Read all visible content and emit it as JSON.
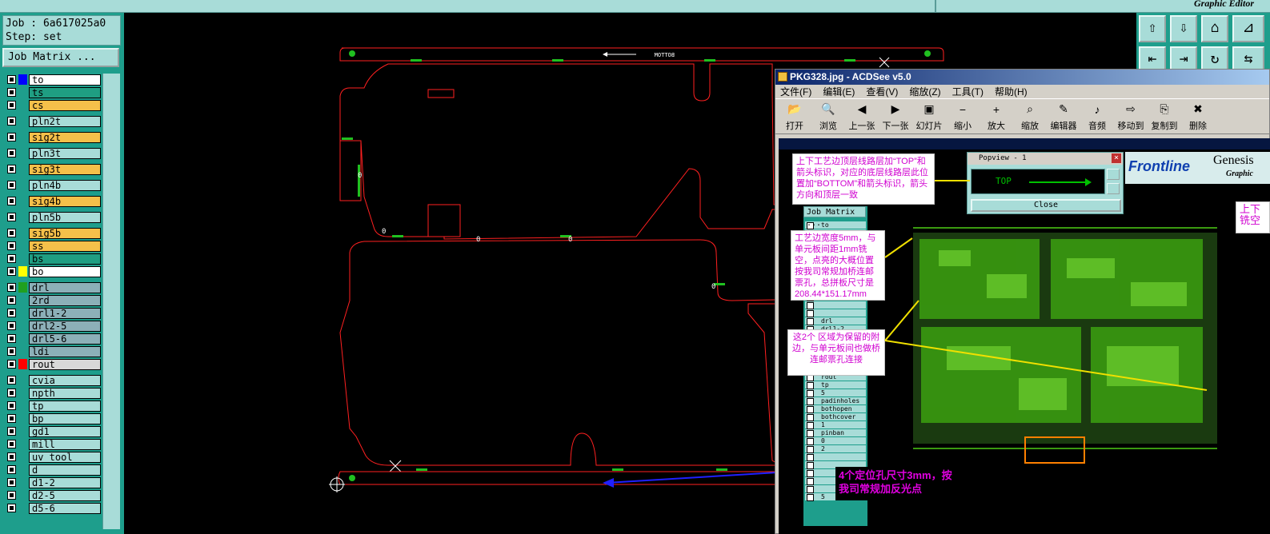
{
  "topbar": {
    "title": "Graphic Editor"
  },
  "job": {
    "job_line": "Job : 6a617025a0",
    "step_line": "Step: set"
  },
  "job_matrix_label": "Job Matrix ...",
  "layers": [
    {
      "name": "to",
      "color": "#0000ff",
      "bg": "#ffffff",
      "gap": false
    },
    {
      "name": "ts",
      "color": "",
      "bg": "#1f9e82",
      "gap": false
    },
    {
      "name": "cs",
      "color": "",
      "bg": "#f5c04a",
      "gap": false
    },
    {
      "name": "pln2t",
      "color": "",
      "bg": "#a8dcd8",
      "gap": true
    },
    {
      "name": "sig2t",
      "color": "",
      "bg": "#f5c04a",
      "gap": true
    },
    {
      "name": "pln3t",
      "color": "",
      "bg": "#a8dcd8",
      "gap": true
    },
    {
      "name": "sig3t",
      "color": "",
      "bg": "#f5c04a",
      "gap": true
    },
    {
      "name": "pln4b",
      "color": "",
      "bg": "#a8dcd8",
      "gap": true
    },
    {
      "name": "sig4b",
      "color": "",
      "bg": "#f5c04a",
      "gap": true
    },
    {
      "name": "pln5b",
      "color": "",
      "bg": "#a8dcd8",
      "gap": true
    },
    {
      "name": "sig5b",
      "color": "",
      "bg": "#f5c04a",
      "gap": true
    },
    {
      "name": "ss",
      "color": "",
      "bg": "#f5c04a",
      "gap": false
    },
    {
      "name": "bs",
      "color": "",
      "bg": "#1f9e82",
      "gap": false
    },
    {
      "name": "bo",
      "color": "#ffff00",
      "bg": "#ffffff",
      "gap": false
    },
    {
      "name": "drl",
      "color": "#20a020",
      "bg": "#8cb0b8",
      "gap": true
    },
    {
      "name": "2rd",
      "color": "",
      "bg": "#8cb0b8",
      "gap": false
    },
    {
      "name": "drl1-2",
      "color": "",
      "bg": "#8cb0b8",
      "gap": false
    },
    {
      "name": "drl2-5",
      "color": "",
      "bg": "#8cb0b8",
      "gap": false
    },
    {
      "name": "drl5-6",
      "color": "",
      "bg": "#8cb0b8",
      "gap": false
    },
    {
      "name": "ldi",
      "color": "",
      "bg": "#8cb0b8",
      "gap": false
    },
    {
      "name": "rout",
      "color": "#ff0000",
      "bg": "#d8d8d8",
      "gap": false
    },
    {
      "name": "cvia",
      "color": "",
      "bg": "#a8dcd8",
      "gap": true
    },
    {
      "name": "npth",
      "color": "",
      "bg": "#a8dcd8",
      "gap": false
    },
    {
      "name": "tp",
      "color": "",
      "bg": "#a8dcd8",
      "gap": false
    },
    {
      "name": "bp",
      "color": "",
      "bg": "#a8dcd8",
      "gap": false
    },
    {
      "name": "gd1",
      "color": "",
      "bg": "#a8dcd8",
      "gap": false
    },
    {
      "name": "mill",
      "color": "",
      "bg": "#a8dcd8",
      "gap": false
    },
    {
      "name": "uv_tool",
      "color": "",
      "bg": "#a8dcd8",
      "gap": false
    },
    {
      "name": "d",
      "color": "",
      "bg": "#a8dcd8",
      "gap": false
    },
    {
      "name": "d1-2",
      "color": "",
      "bg": "#a8dcd8",
      "gap": false
    },
    {
      "name": "d2-5",
      "color": "",
      "bg": "#a8dcd8",
      "gap": false
    },
    {
      "name": "d5-6",
      "color": "",
      "bg": "#a8dcd8",
      "gap": false
    }
  ],
  "canvas": {
    "bottom_label": "BOTTOM"
  },
  "acdsee": {
    "title": "PKG328.jpg - ACDSee v5.0",
    "menu": [
      "文件(F)",
      "编辑(E)",
      "查看(V)",
      "缩放(Z)",
      "工具(T)",
      "帮助(H)"
    ],
    "tools": [
      {
        "label": "打开",
        "icon": "open-folder-icon",
        "glyph": "📂"
      },
      {
        "label": "浏览",
        "icon": "browse-icon",
        "glyph": "🔍"
      },
      {
        "label": "上一张",
        "icon": "prev-icon",
        "glyph": "◀"
      },
      {
        "label": "下一张",
        "icon": "next-icon",
        "glyph": "▶"
      },
      {
        "label": "幻灯片",
        "icon": "slideshow-icon",
        "glyph": "▣"
      },
      {
        "label": "缩小",
        "icon": "zoom-out-icon",
        "glyph": "−"
      },
      {
        "label": "放大",
        "icon": "zoom-in-icon",
        "glyph": "+"
      },
      {
        "label": "缩放",
        "icon": "zoom-icon",
        "glyph": "⌕"
      },
      {
        "label": "编辑器",
        "icon": "editor-icon",
        "glyph": "✎"
      },
      {
        "label": "音频",
        "icon": "audio-icon",
        "glyph": "♪"
      },
      {
        "label": "移动到",
        "icon": "move-icon",
        "glyph": "⇨"
      },
      {
        "label": "复制到",
        "icon": "copy-icon",
        "glyph": "⎘"
      },
      {
        "label": "删除",
        "icon": "delete-icon",
        "glyph": "✖"
      }
    ]
  },
  "popview": {
    "title": "Popview - 1",
    "top_label": "TOP",
    "close_label": "Close"
  },
  "frontline": {
    "brand": "Frontline",
    "product": "Genesis",
    "sub": "Graphic"
  },
  "notes": {
    "note1": "上下工艺边顶层线路层加“TOP”和箭头标识，对应的底层线路层此位置加“BOTTOM”和箭头标识，箭头方向和顶层一致",
    "note2": "工艺边宽度5mm，与单元板间距1mm铣空，点亮的大概位置按我司常规加桥连邮票孔，总拼板尺寸是208.44*151.17mm",
    "note3": "这2个 区域为保留的附边，与单元板间也做桥连邮票孔连接",
    "note4": "4个定位孔尺寸3mm，按我司常规加反光点",
    "note5": "上下铣空"
  },
  "inner_panel": {
    "job_matrix": "Job Matrix ...",
    "layers": [
      "to",
      "",
      "",
      "",
      "",
      "",
      "",
      "",
      "",
      "",
      "",
      "",
      "drl",
      "drl1-2",
      "",
      "",
      "",
      "",
      "",
      "rout",
      "tp",
      "5",
      "padinholes",
      "bothopen",
      "bothcover",
      "1",
      "pinban",
      "0",
      "2",
      "",
      "",
      "",
      "",
      "",
      "5"
    ]
  },
  "colors": {
    "panel": "#1e9e8c",
    "light": "#a8dcd8",
    "outline": "#ff2020",
    "pcb": "#3a9a10"
  }
}
